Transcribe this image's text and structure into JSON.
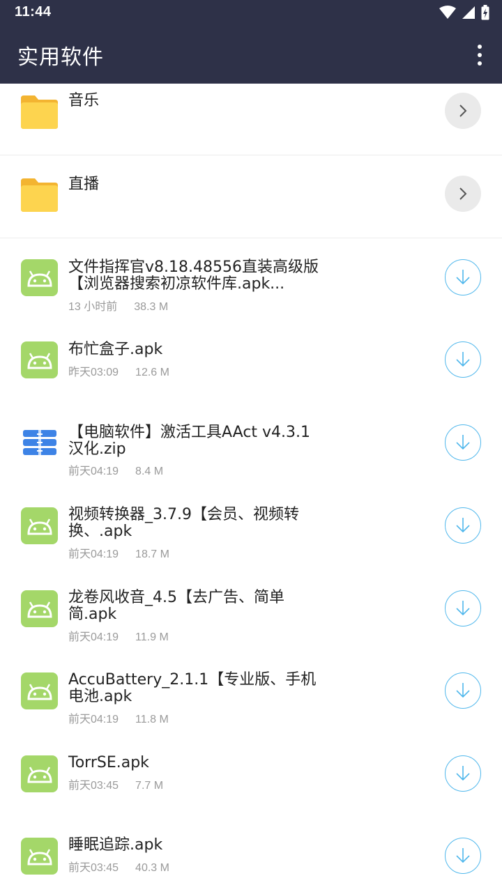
{
  "status": {
    "time": "11:44"
  },
  "appbar": {
    "title": "实用软件"
  },
  "folders": [
    {
      "name": "音乐"
    },
    {
      "name": "直播"
    }
  ],
  "files": [
    {
      "name_line1": "文件指挥官v8.18.48556直装高级版",
      "name_line2": "【浏览器搜索初凉软件库.apk...",
      "time": "13 小时前",
      "size": "38.3 M",
      "type": "apk"
    },
    {
      "name_line1": "布忙盒子.apk",
      "name_line2": "",
      "time": "昨天03:09",
      "size": "12.6 M",
      "type": "apk"
    },
    {
      "name_line1": "【电脑软件】激活工具AAct v4.3.1",
      "name_line2": "汉化.zip",
      "time": "前天04:19",
      "size": "8.4 M",
      "type": "zip"
    },
    {
      "name_line1": "视频转换器_3.7.9【会员、视频转",
      "name_line2": "换、.apk",
      "time": "前天04:19",
      "size": "18.7 M",
      "type": "apk"
    },
    {
      "name_line1": "龙卷风收音_4.5【去广告、简单",
      "name_line2": "简.apk",
      "time": "前天04:19",
      "size": "11.9 M",
      "type": "apk"
    },
    {
      "name_line1": "AccuBattery_2.1.1【专业版、手机",
      "name_line2": "电池.apk",
      "time": "前天04:19",
      "size": "11.8 M",
      "type": "apk"
    },
    {
      "name_line1": "TorrSE.apk",
      "name_line2": "",
      "time": "前天03:45",
      "size": "7.7 M",
      "type": "apk"
    },
    {
      "name_line1": "睡眠追踪.apk",
      "name_line2": "",
      "time": "前天03:45",
      "size": "40.3 M",
      "type": "apk"
    }
  ],
  "colors": {
    "bar": "#2e3148",
    "folder": "#fdd44f",
    "folder_tab": "#f3b431",
    "android": "#a4d769",
    "download": "#4fb7ec",
    "zip": "#3d83e6"
  }
}
